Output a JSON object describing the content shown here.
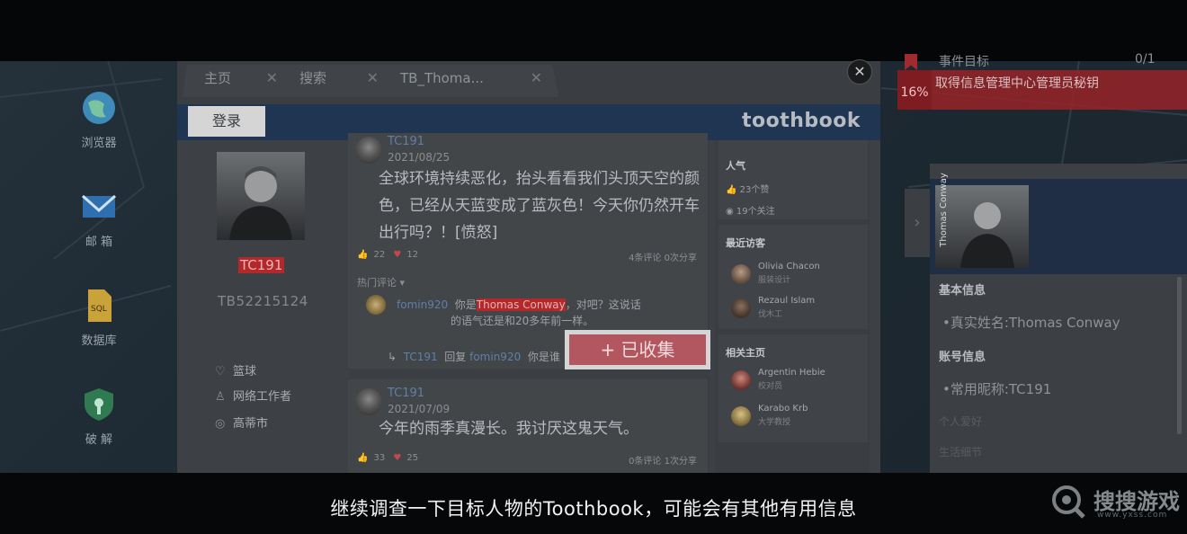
{
  "desktop": {
    "icons": [
      {
        "label": "浏览器",
        "icon": "globe-icon"
      },
      {
        "label": "邮 箱",
        "icon": "mail-icon"
      },
      {
        "label": "数据库",
        "icon": "sql-file-icon"
      },
      {
        "label": "破 解",
        "icon": "shield-key-icon"
      }
    ]
  },
  "browser": {
    "tabs": [
      {
        "label": "主页",
        "close": "✕"
      },
      {
        "label": "搜索",
        "close": "✕"
      },
      {
        "label": "TB_Thoma...",
        "close": "✕"
      }
    ],
    "close_glyph": "✕",
    "login_label": "登录",
    "brand": "toothbook"
  },
  "profile": {
    "username": "TC191",
    "user_id": "TB52215124",
    "details": [
      {
        "icon": "heart-icon",
        "glyph": "♡",
        "text": "篮球"
      },
      {
        "icon": "tie-icon",
        "glyph": "♙",
        "text": "网络工作者"
      },
      {
        "icon": "location-icon",
        "glyph": "◎",
        "text": "高蒂市"
      }
    ]
  },
  "posts": [
    {
      "author": "TC191",
      "date": "2021/08/25",
      "text": "全球环境持续恶化，抬头看看我们头顶天空的颜色，已经从天蓝变成了蓝灰色！今天你仍然开车出行吗？！[愤怒]",
      "likes": "22",
      "hearts": "12",
      "comments": "4条评论",
      "shares": "0次分享",
      "hot_label": "热门评论 ▾",
      "comment1": {
        "name": "fomin920",
        "pre": "你是",
        "highlight": "Thomas Conway",
        "post": "，对吧？这说话",
        "line2": "的语气还是和20多年前一样。"
      },
      "comment2": {
        "name": "TC191",
        "reply": "回复",
        "target": "fomin920",
        "text": "你是谁"
      }
    },
    {
      "author": "TC191",
      "date": "2021/07/09",
      "text": "今年的雨季真漫长。我讨厌这鬼天气。",
      "likes": "33",
      "hearts": "25",
      "comments": "0条评论",
      "shares": "1次分享"
    }
  ],
  "sidebar": {
    "popularity_title": "人气",
    "likes": "23个赞",
    "follows": "19个关注",
    "visitors_title": "最近访客",
    "visitors": [
      {
        "name": "Olivia Chacon",
        "role": "服装设计"
      },
      {
        "name": "Rezaul Islam",
        "role": "伐木工"
      }
    ],
    "related_title": "相关主页",
    "related": [
      {
        "name": "Argentin Hebie",
        "role": "校对员"
      },
      {
        "name": "Karabo Krb",
        "role": "大学教授"
      }
    ]
  },
  "collect_button": "+ 已收集",
  "goal": {
    "title": "事件目标",
    "count": "0/1",
    "percent": "16%",
    "text": "取得信息管理中心管理员秘钥"
  },
  "info_panel": {
    "vertical_name": "Thomas Conway",
    "basic_label": "基本信息",
    "real_name": "•真实姓名:Thomas Conway",
    "account_label": "账号信息",
    "nickname": "•常用昵称:TC191",
    "dim1": "个人爱好",
    "dim2": "生活细节",
    "handle_glyph": "›"
  },
  "subtitle": "继续调查一下目标人物的Toothbook，可能会有其他有用信息",
  "watermark": {
    "text": "搜搜游戏",
    "sub": "www.yxss.com"
  }
}
